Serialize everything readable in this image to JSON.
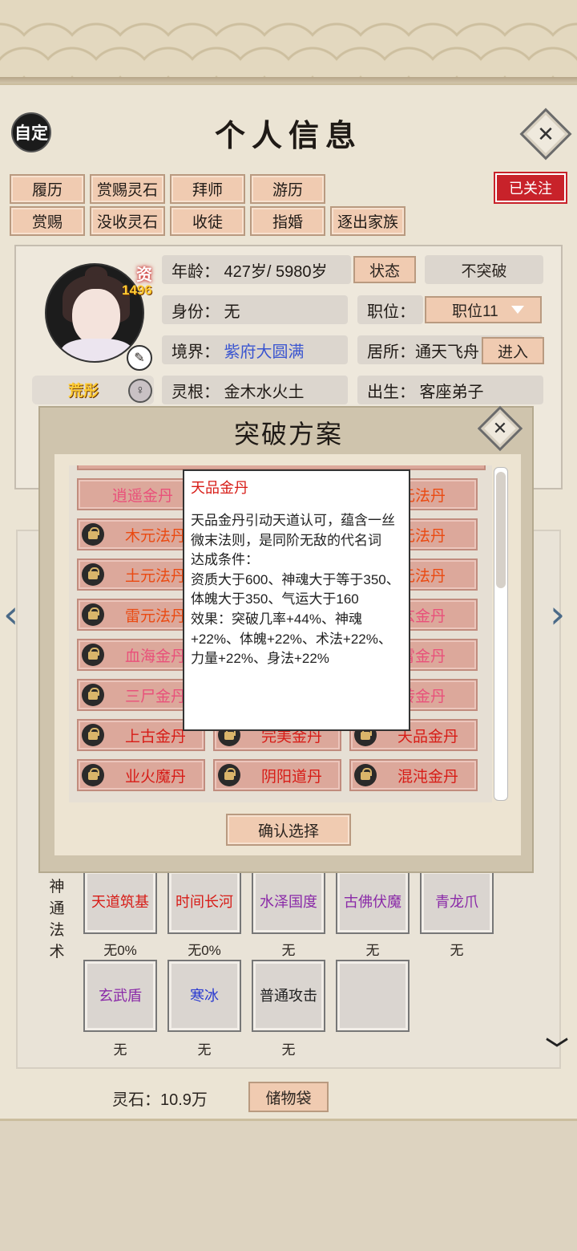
{
  "header": {
    "title": "个人信息",
    "custom_label": "自定"
  },
  "actions_row1": [
    "履历",
    "赏赐灵石",
    "拜师",
    "游历"
  ],
  "actions_row2": [
    "赏赐",
    "没收灵石",
    "收徒",
    "指婚",
    "逐出家族"
  ],
  "follow_label": "已关注",
  "profile": {
    "zi_label": "资",
    "zi_value": "1496",
    "name": "荒彤",
    "age": "年龄：  427岁/ 5980岁",
    "status_btn": "状态",
    "no_breakthrough": "不突破",
    "identity": "身份：  无",
    "position_label": "职位：",
    "position_value": "职位11",
    "realm_label": "境界：",
    "realm_value": "紫府大圆满",
    "residence": "居所：通天飞舟",
    "enter_btn": "进入",
    "root": "灵根：  金木水火土",
    "birth": "出生：  客座弟子"
  },
  "modal": {
    "title": "突破方案",
    "confirm": "确认选择",
    "items": [
      {
        "label": "逍遥金丹",
        "color": "#e9517a",
        "lock": false
      },
      {
        "label": "天品金丹",
        "color": "#d71c17",
        "lock": false
      },
      {
        "label": "玄元法丹",
        "color": "#ea4a12",
        "lock": false
      },
      {
        "label": "木元法丹",
        "color": "#ea4a12",
        "lock": true
      },
      {
        "label": "天品金丹",
        "color": "#d71c17",
        "lock": false
      },
      {
        "label": "水元法丹",
        "color": "#ea4a12",
        "lock": false
      },
      {
        "label": "土元法丹",
        "color": "#ea4a12",
        "lock": true
      },
      {
        "label": "天品金丹",
        "color": "#d71c17",
        "lock": false
      },
      {
        "label": "火元法丹",
        "color": "#ea4a12",
        "lock": false
      },
      {
        "label": "雷元法丹",
        "color": "#ea4a12",
        "lock": true
      },
      {
        "label": "天品金丹",
        "color": "#d71c17",
        "lock": false
      },
      {
        "label": "太玄金丹",
        "color": "#e9517a",
        "lock": false
      },
      {
        "label": "血海金丹",
        "color": "#e9517a",
        "lock": true
      },
      {
        "label": "天品金丹",
        "color": "#d71c17",
        "lock": false
      },
      {
        "label": "紫霄金丹",
        "color": "#e9517a",
        "lock": false
      },
      {
        "label": "三尸金丹",
        "color": "#e9517a",
        "lock": true
      },
      {
        "label": "天品金丹",
        "color": "#d71c17",
        "lock": false
      },
      {
        "label": "九转金丹",
        "color": "#e9517a",
        "lock": false
      },
      {
        "label": "上古金丹",
        "color": "#d71c17",
        "lock": true
      },
      {
        "label": "完美金丹",
        "color": "#d71c17",
        "lock": true
      },
      {
        "label": "天品金丹",
        "color": "#d71c17",
        "lock": true
      },
      {
        "label": "业火魔丹",
        "color": "#d71c17",
        "lock": true
      },
      {
        "label": "阴阳道丹",
        "color": "#d71c17",
        "lock": true
      },
      {
        "label": "混沌金丹",
        "color": "#d71c17",
        "lock": true
      }
    ]
  },
  "tooltip": {
    "title": "天品金丹",
    "body": "天品金丹引动天道认可，蕴含一丝微末法则，是同阶无敌的代名词\n达成条件：\n资质大于600、神魂大于等于350、体魄大于350、气运大于160\n效果：突破几率+44%、神魂+22%、体魄+22%、术法+22%、力量+22%、身法+22%"
  },
  "skills": {
    "label": "神通法术",
    "row1": [
      {
        "name": "天道筑基",
        "color": "#d71c17",
        "sub": "无0%"
      },
      {
        "name": "时间长河",
        "color": "#d71c17",
        "sub": "无0%"
      },
      {
        "name": "水泽国度",
        "color": "#8a2aa8",
        "sub": "无"
      },
      {
        "name": "古佛伏魔",
        "color": "#8a2aa8",
        "sub": "无"
      },
      {
        "name": "青龙爪",
        "color": "#8a2aa8",
        "sub": "无"
      }
    ],
    "row2": [
      {
        "name": "玄武盾",
        "color": "#8a2aa8",
        "sub": "无"
      },
      {
        "name": "寒冰",
        "color": "#2a3ad0",
        "sub": "无"
      },
      {
        "name": "普通攻击",
        "color": "#222222",
        "sub": "无"
      },
      {
        "name": "",
        "color": "#222222",
        "sub": ""
      }
    ]
  },
  "footer": {
    "stone": "灵石：10.9万",
    "bag": "储物袋"
  }
}
